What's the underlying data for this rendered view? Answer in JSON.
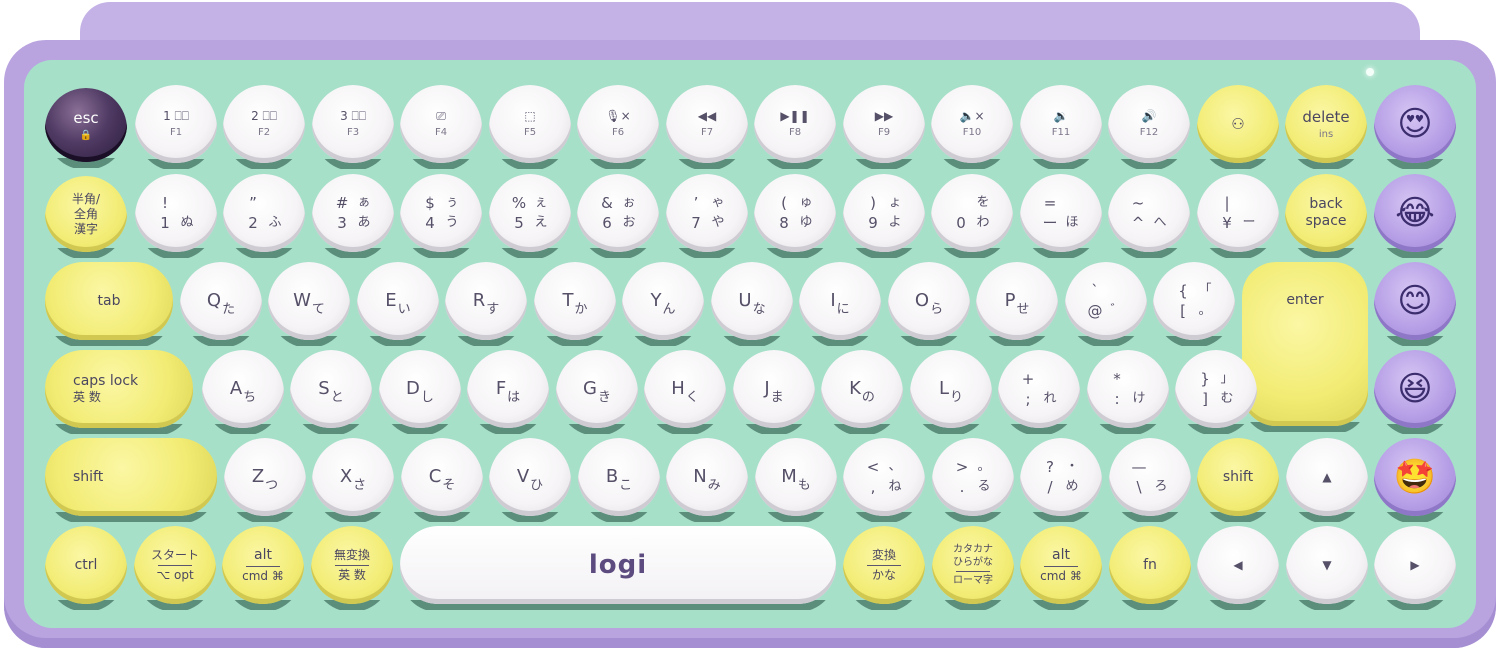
{
  "brand": {
    "logo": "logi"
  },
  "row1": [
    {
      "main": "esc",
      "sub": "🔒"
    },
    {
      "main": "1 ⎕⎕",
      "sub": "F1"
    },
    {
      "main": "2 ⎕⎕",
      "sub": "F2"
    },
    {
      "main": "3 ⎕⎕",
      "sub": "F3"
    },
    {
      "main": "⎚",
      "sub": "F4"
    },
    {
      "main": "⬚",
      "sub": "F5"
    },
    {
      "main": "🎙×",
      "sub": "F6"
    },
    {
      "main": "◀◀",
      "sub": "F7"
    },
    {
      "main": "▶❚❚",
      "sub": "F8"
    },
    {
      "main": "▶▶",
      "sub": "F9"
    },
    {
      "main": "🔈×",
      "sub": "F10"
    },
    {
      "main": "🔉",
      "sub": "F11"
    },
    {
      "main": "🔊",
      "sub": "F12"
    },
    {
      "main": "⚇",
      "sub": ""
    },
    {
      "main": "delete",
      "sub": "ins"
    }
  ],
  "row2": [
    {
      "a": "半角/",
      "b": "全角",
      "c": "漢字"
    },
    {
      "tl": "!",
      "tr": "",
      "bl": "1",
      "br": "ぬ"
    },
    {
      "tl": "”",
      "tr": "",
      "bl": "2",
      "br": "ふ"
    },
    {
      "tl": "#",
      "tr": "ぁ",
      "bl": "3",
      "br": "あ"
    },
    {
      "tl": "$",
      "tr": "ぅ",
      "bl": "4",
      "br": "う"
    },
    {
      "tl": "%",
      "tr": "ぇ",
      "bl": "5",
      "br": "え"
    },
    {
      "tl": "&",
      "tr": "ぉ",
      "bl": "6",
      "br": "お"
    },
    {
      "tl": "’",
      "tr": "ゃ",
      "bl": "7",
      "br": "や"
    },
    {
      "tl": "(",
      "tr": "ゅ",
      "bl": "8",
      "br": "ゆ"
    },
    {
      "tl": ")",
      "tr": "ょ",
      "bl": "9",
      "br": "よ"
    },
    {
      "tl": "",
      "tr": "を",
      "bl": "0",
      "br": "わ"
    },
    {
      "tl": "=",
      "tr": "",
      "bl": "ー",
      "br": "ほ"
    },
    {
      "tl": "~",
      "tr": "",
      "bl": "^",
      "br": "へ"
    },
    {
      "tl": "|",
      "tr": "",
      "bl": "¥",
      "br": "ー"
    },
    {
      "a": "back",
      "b": "space"
    }
  ],
  "row3": {
    "tab": "tab",
    "keys": [
      {
        "L": "Q",
        "K": "た"
      },
      {
        "L": "W",
        "K": "て"
      },
      {
        "L": "E",
        "K": "い"
      },
      {
        "L": "R",
        "K": "す"
      },
      {
        "L": "T",
        "K": "か"
      },
      {
        "L": "Y",
        "K": "ん"
      },
      {
        "L": "U",
        "K": "な"
      },
      {
        "L": "I",
        "K": "に"
      },
      {
        "L": "O",
        "K": "ら"
      },
      {
        "L": "P",
        "K": "せ"
      }
    ],
    "at": {
      "tl": "`",
      "tr": "",
      "bl": "@",
      "br": "゛"
    },
    "bracket": {
      "tl": "{",
      "tr": "「",
      "bl": "[",
      "br": "。"
    },
    "enter": "enter"
  },
  "row4": {
    "caps": "caps lock",
    "caps_sub": "英 数",
    "keys": [
      {
        "L": "A",
        "K": "ち"
      },
      {
        "L": "S",
        "K": "と"
      },
      {
        "L": "D",
        "K": "し"
      },
      {
        "L": "F",
        "K": "は"
      },
      {
        "L": "G",
        "K": "き"
      },
      {
        "L": "H",
        "K": "く"
      },
      {
        "L": "J",
        "K": "ま"
      },
      {
        "L": "K",
        "K": "の"
      },
      {
        "L": "L",
        "K": "り"
      }
    ],
    "semi": {
      "tl": "+",
      "tr": "",
      "bl": ";",
      "br": "れ"
    },
    "colon": {
      "tl": "*",
      "tr": "",
      "bl": ":",
      "br": "け"
    },
    "rbr": {
      "tl": "}",
      "tr": "」",
      "bl": "]",
      "br": "む"
    }
  },
  "row5": {
    "shift_l": "shift",
    "keys": [
      {
        "L": "Z",
        "K": "つ"
      },
      {
        "L": "X",
        "K": "さ"
      },
      {
        "L": "C",
        "K": "そ"
      },
      {
        "L": "V",
        "K": "ひ"
      },
      {
        "L": "B",
        "K": "こ"
      },
      {
        "L": "N",
        "K": "み"
      },
      {
        "L": "M",
        "K": "も"
      }
    ],
    "comma": {
      "tl": "<",
      "tr": "、",
      "bl": ",",
      "br": "ね"
    },
    "period": {
      "tl": ">",
      "tr": "。",
      "bl": ".",
      "br": "る"
    },
    "slash": {
      "tl": "?",
      "tr": "・",
      "bl": "/",
      "br": "め"
    },
    "ro": {
      "tl": "—",
      "tr": "",
      "bl": "\\",
      "br": "ろ"
    },
    "shift_r": "shift",
    "up": "▲"
  },
  "row6": {
    "ctrl": "ctrl",
    "start_top": "スタート",
    "start_bottom": "⌥ opt",
    "alt_top": "alt",
    "alt_bottom": "cmd ⌘",
    "muhenkan_top": "無変換",
    "muhenkan_bottom": "英 数",
    "henkan_top": "変換",
    "henkan_bottom": "かな",
    "kana_top": "カタカナ",
    "kana_mid": "ひらがな",
    "kana_bottom": "ローマ字",
    "alt2_top": "alt",
    "alt2_bottom": "cmd ⌘",
    "fn": "fn",
    "left": "◀",
    "down": "▼",
    "right": "▶"
  },
  "emoji": [
    "😍",
    "😂",
    "😊",
    "😆",
    "🤩"
  ],
  "colors": {
    "chassis": "#b9a4e0",
    "plate": "#a6e0c9",
    "white_key": "#f6f4f6",
    "yellow_key": "#f2ec74",
    "purple_key": "#b49ce5"
  }
}
